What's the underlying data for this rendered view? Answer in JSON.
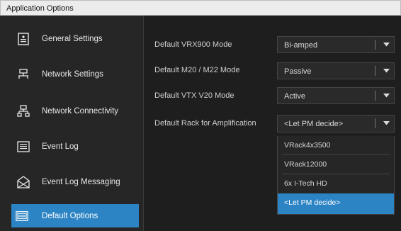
{
  "window": {
    "title": "Application Options"
  },
  "sidebar": {
    "items": [
      {
        "label": "General Settings",
        "icon": "settings-doc-icon"
      },
      {
        "label": "Network Settings",
        "icon": "network-icon"
      },
      {
        "label": "Network Connectivity",
        "icon": "network-connectivity-icon"
      },
      {
        "label": "Event Log",
        "icon": "event-log-icon"
      },
      {
        "label": "Event Log Messaging",
        "icon": "envelope-icon"
      },
      {
        "label": "Default Options",
        "icon": "default-options-icon",
        "selected": true
      }
    ]
  },
  "main": {
    "rows": [
      {
        "label": "Default VRX900 Mode",
        "value": "Bi-amped"
      },
      {
        "label": "Default M20 / M22 Mode",
        "value": "Passive"
      },
      {
        "label": "Default VTX V20 Mode",
        "value": "Active"
      },
      {
        "label": "Default Rack for Amplification",
        "value": "<Let PM decide>"
      }
    ],
    "open_dropdown": {
      "options": [
        "VRack4x3500",
        "VRack12000",
        "6x I-Tech HD",
        "<Let PM decide>"
      ],
      "selected_index": 3
    }
  },
  "colors": {
    "accent": "#2d84c4",
    "background": "#1e1e1e",
    "sidebar": "#262626",
    "text": "#e8e8e8"
  }
}
